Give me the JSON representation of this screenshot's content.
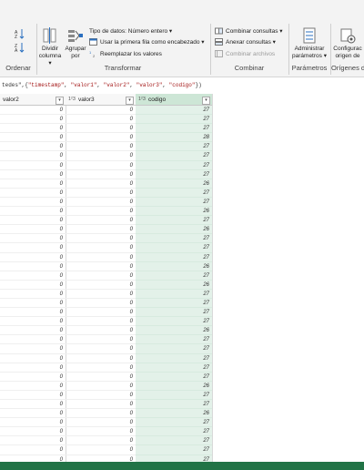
{
  "ribbon": {
    "ordenar": {
      "label": "Ordenar"
    },
    "transformar": {
      "label": "Transformar",
      "dividir_columna": [
        "Dividir",
        "columna ▾"
      ],
      "agrupar_por": [
        "Agrupar",
        "por"
      ],
      "tipo_datos": "Tipo de datos: Número entero ▾",
      "primera_fila": "Usar la primera fila como encabezado ▾",
      "reemplazar": "Reemplazar los valores"
    },
    "combinar": {
      "label": "Combinar",
      "combinar_consultas": "Combinar consultas ▾",
      "anexar_consultas": "Anexar consultas ▾",
      "combinar_archivos": "Combinar archivos"
    },
    "parametros": {
      "label": "Parámetros",
      "administrar": [
        "Administrar",
        "parámetros ▾"
      ]
    },
    "origenes": {
      "label": "Orígenes de",
      "configuracion": [
        "Configurac",
        "origen de"
      ]
    }
  },
  "formula": {
    "prefix": "tedes\",{",
    "items": [
      "\"timestamp\"",
      "\"valor1\"",
      "\"valor2\"",
      "\"valor3\"",
      "\"codigo\""
    ],
    "suffix": "})"
  },
  "columns": {
    "valor2": {
      "label": "valor2",
      "type": "",
      "dd": "▾"
    },
    "valor3": {
      "label": "valor3",
      "type": "1²3",
      "dd": "▾"
    },
    "codigo": {
      "label": "codigo",
      "type": "1²3",
      "dd": "▾"
    }
  },
  "rows": [
    [
      "0",
      "0",
      "27"
    ],
    [
      "0",
      "0",
      "27"
    ],
    [
      "0",
      "0",
      "27"
    ],
    [
      "0",
      "0",
      "28"
    ],
    [
      "0",
      "0",
      "27"
    ],
    [
      "0",
      "0",
      "27"
    ],
    [
      "0",
      "0",
      "27"
    ],
    [
      "0",
      "0",
      "27"
    ],
    [
      "0",
      "0",
      "26"
    ],
    [
      "0",
      "0",
      "27"
    ],
    [
      "0",
      "0",
      "27"
    ],
    [
      "0",
      "0",
      "26"
    ],
    [
      "0",
      "0",
      "27"
    ],
    [
      "0",
      "0",
      "26"
    ],
    [
      "0",
      "0",
      "27"
    ],
    [
      "0",
      "0",
      "27"
    ],
    [
      "0",
      "0",
      "27"
    ],
    [
      "0",
      "0",
      "26"
    ],
    [
      "0",
      "0",
      "27"
    ],
    [
      "0",
      "0",
      "26"
    ],
    [
      "0",
      "0",
      "27"
    ],
    [
      "0",
      "0",
      "27"
    ],
    [
      "0",
      "0",
      "27"
    ],
    [
      "0",
      "0",
      "27"
    ],
    [
      "0",
      "0",
      "26"
    ],
    [
      "0",
      "0",
      "27"
    ],
    [
      "0",
      "0",
      "27"
    ],
    [
      "0",
      "0",
      "27"
    ],
    [
      "0",
      "0",
      "27"
    ],
    [
      "0",
      "0",
      "27"
    ],
    [
      "0",
      "0",
      "26"
    ],
    [
      "0",
      "0",
      "27"
    ],
    [
      "0",
      "0",
      "27"
    ],
    [
      "0",
      "0",
      "26"
    ],
    [
      "0",
      "0",
      "27"
    ],
    [
      "0",
      "0",
      "27"
    ],
    [
      "0",
      "0",
      "27"
    ],
    [
      "0",
      "0",
      "27"
    ],
    [
      "0",
      "0",
      "27"
    ]
  ]
}
